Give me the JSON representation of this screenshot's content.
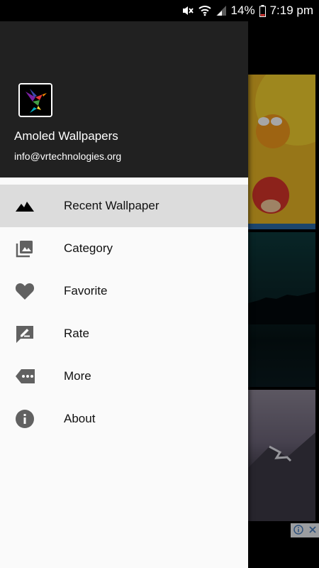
{
  "status_bar": {
    "battery": "14%",
    "time": "7:19 pm"
  },
  "drawer": {
    "app_name": "Amoled Wallpapers",
    "email": "info@vrtechnologies.org",
    "items": [
      {
        "label": "Recent Wallpaper",
        "icon": "landscape-icon",
        "active": true
      },
      {
        "label": "Category",
        "icon": "photo-library-icon",
        "active": false
      },
      {
        "label": "Favorite",
        "icon": "heart-icon",
        "active": false
      },
      {
        "label": "Rate",
        "icon": "rate-review-icon",
        "active": false
      },
      {
        "label": "More",
        "icon": "more-label-icon",
        "active": false
      },
      {
        "label": "About",
        "icon": "info-icon",
        "active": false
      }
    ]
  },
  "colors": {
    "drawer_header": "#212121",
    "drawer_body": "#fafafa",
    "active_item": "#dcdcdc",
    "icon": "#616161"
  }
}
